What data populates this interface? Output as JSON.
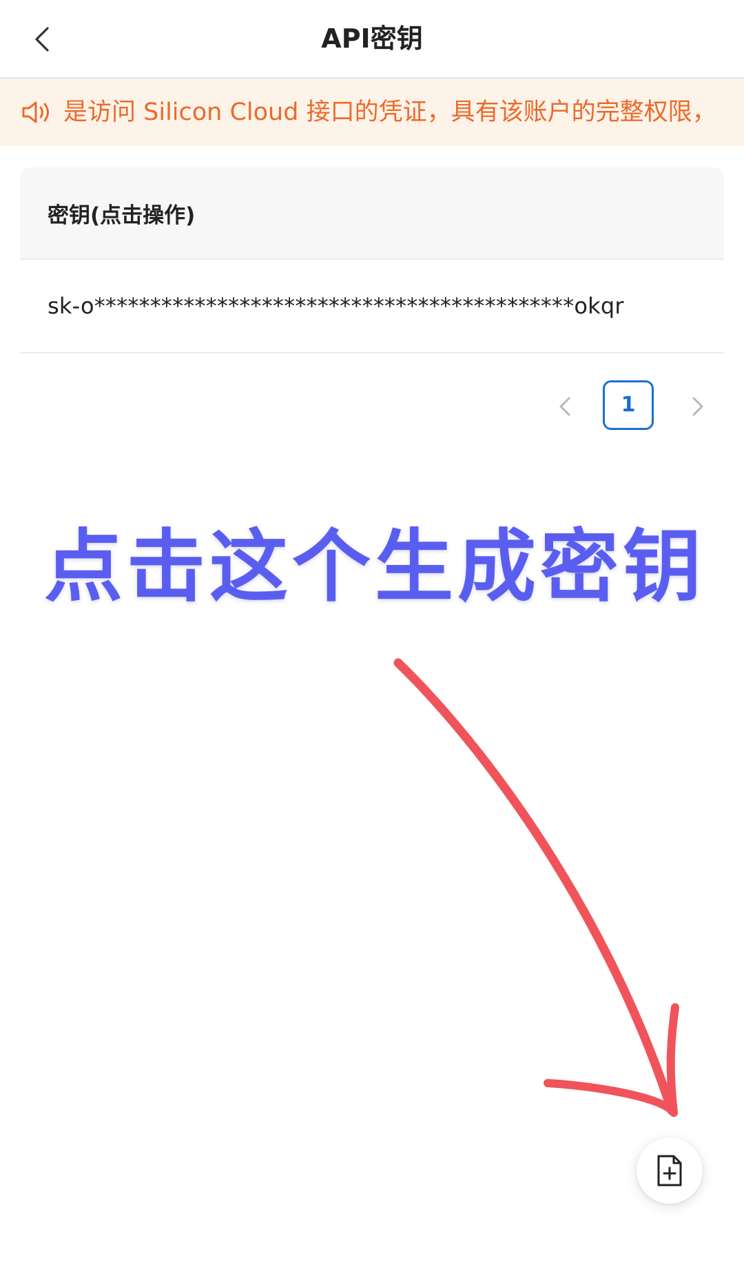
{
  "header": {
    "title": "API密钥",
    "back_icon": "chevron-left-icon"
  },
  "notice": {
    "icon": "speaker-icon",
    "text": "是访问 Silicon Cloud 接口的凭证，具有该账户的完整权限，",
    "color": "#ec6a2a",
    "background": "#fdf3e9"
  },
  "table": {
    "column_header": "密钥(点击操作)",
    "rows": [
      {
        "key": "sk-o*******************************************okqr"
      }
    ]
  },
  "pagination": {
    "current_page": "1",
    "prev_icon": "chevron-left-icon",
    "next_icon": "chevron-right-icon",
    "accent": "#1a6fd0"
  },
  "annotation": {
    "text": "点击这个生成密钥",
    "color_start": "#5a5ef0",
    "color_end": "#6a6ae6",
    "arrow_color": "#f0545a"
  },
  "fab": {
    "icon": "file-plus-icon"
  }
}
